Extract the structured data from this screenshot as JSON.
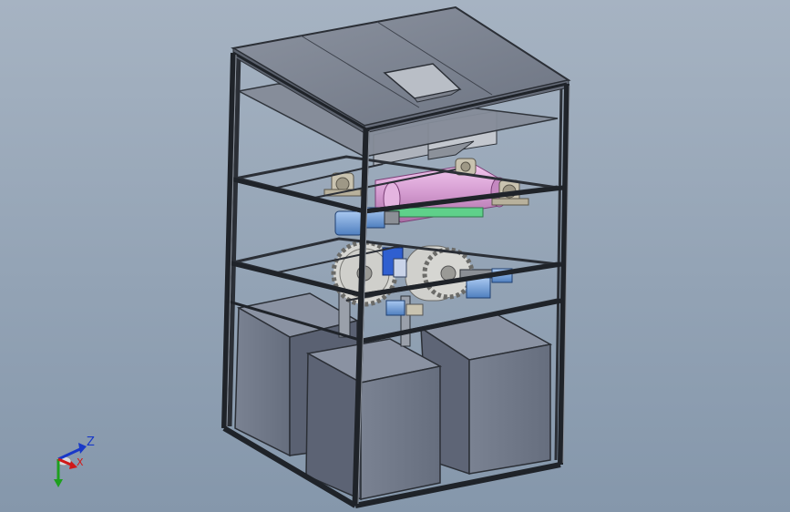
{
  "view": {
    "type": "cad-3d-assembly",
    "projection": "isometric",
    "background_colors": [
      "#a6b3c2",
      "#8597ab"
    ]
  },
  "triad": {
    "labels": {
      "z": "Z",
      "x": "X"
    },
    "colors": {
      "x": "#d01818",
      "y": "#1ea01e",
      "z": "#1838c8"
    }
  },
  "colors": {
    "frame": "#2b2f36",
    "panel_top": "#7d8592",
    "panel_side": "#8e95a2",
    "bin_front": "#6e7686",
    "bin_side": "#596070",
    "roller": "#d49bd0",
    "motor": "#6f9ed8",
    "gear": "#d6d6d2",
    "guard": "#2f5fd0",
    "belt": "#5fd08a",
    "bearing": "#c9c3b0"
  },
  "components": {
    "frame": "aluminium-profile-frame",
    "top_cover": "top-cover-with-feed-hatch",
    "shelf_count": 3,
    "rollers": 1,
    "gears": 2,
    "motors": 3,
    "bins": 3
  }
}
